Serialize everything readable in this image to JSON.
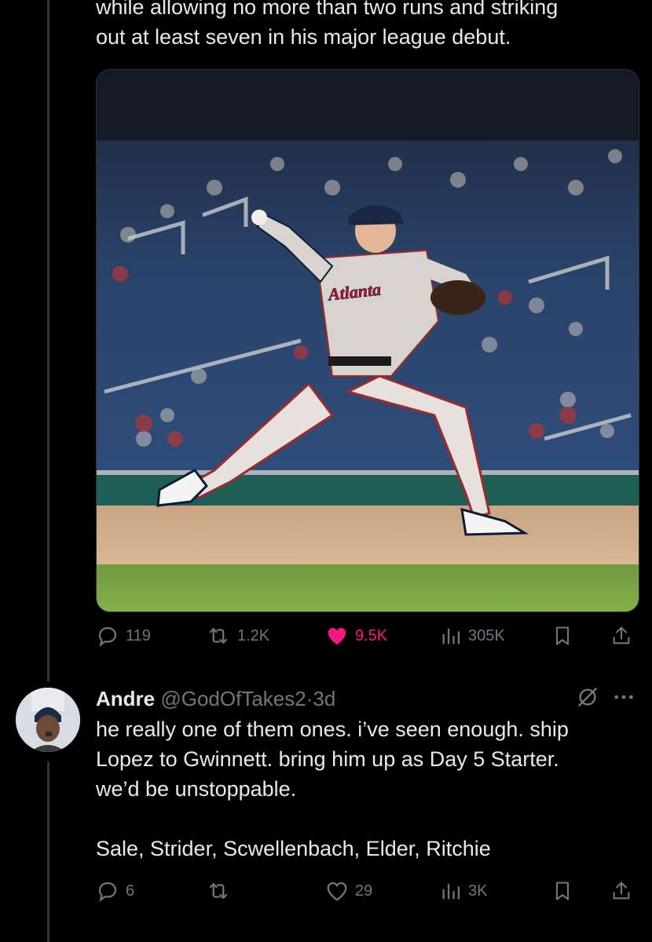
{
  "tweet": {
    "text_line_1": "while allowing no more than two runs and striking",
    "text_line_2": "out at least seven in his major league debut.",
    "photo": {
      "jersey_text": "Atlanta"
    },
    "stats": {
      "replies": "119",
      "reposts": "1.2K",
      "likes": "9.5K",
      "views": "305K"
    },
    "liked": true,
    "like_color": "#f91880"
  },
  "reply": {
    "name": "Andre",
    "handle": "@GodOfTakes2",
    "separator": "·",
    "time": "3d",
    "body_lines": [
      "he really one of them ones. i’ve seen enough. ship",
      "Lopez to Gwinnett. bring him up as Day 5 Starter.",
      "we’d be unstoppable."
    ],
    "body_last": "Sale, Strider, Scwellenbach, Elder, Ritchie",
    "stats": {
      "replies": "6",
      "reposts": "",
      "likes": "29",
      "views": "3K"
    }
  },
  "icons": {
    "reply": "reply-icon",
    "repost": "repost-icon",
    "like": "heart-icon",
    "views": "views-icon",
    "bookmark": "bookmark-icon",
    "share": "share-icon",
    "grok": "grok-icon",
    "more": "more-icon"
  },
  "colors": {
    "background": "#000000",
    "text": "#e7e9ea",
    "muted": "#71767b",
    "like": "#f91880"
  }
}
